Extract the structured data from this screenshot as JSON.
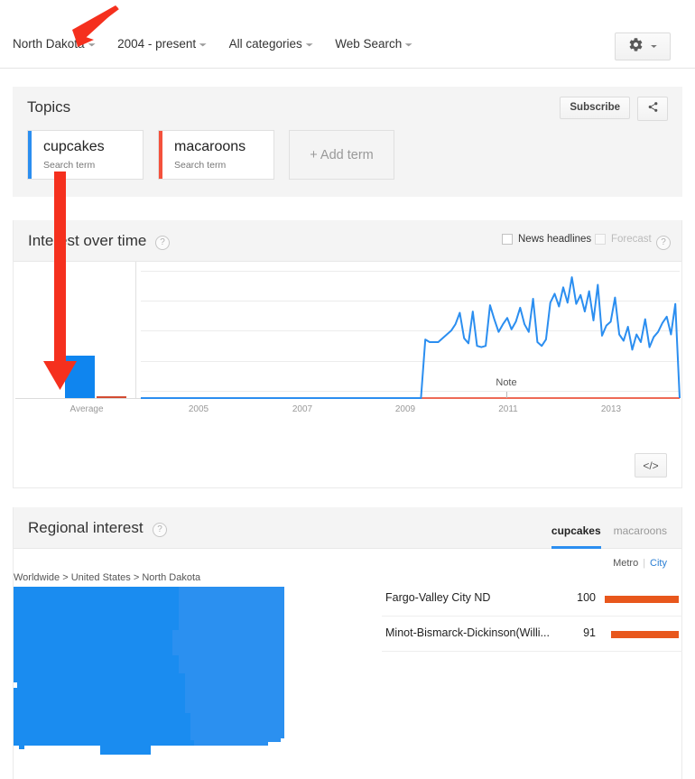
{
  "nav": {
    "items": [
      {
        "label": "North Dakota",
        "name": "region-selector"
      },
      {
        "label": "2004 - present",
        "name": "time-range-selector"
      },
      {
        "label": "All categories",
        "name": "category-selector"
      },
      {
        "label": "Web Search",
        "name": "search-type-selector"
      }
    ],
    "caret": "▾",
    "settings_icon": "gear-icon"
  },
  "topics": {
    "title": "Topics",
    "subscribe_label": "Subscribe",
    "share_icon": "share-icon",
    "terms": [
      {
        "name": "cupcakes",
        "subtitle": "Search term",
        "color": "#2b8ef0"
      },
      {
        "name": "macaroons",
        "subtitle": "Search term",
        "color": "#f4513c"
      }
    ],
    "add_term_label": "+ Add term"
  },
  "interest_over_time": {
    "title": "Interest over time",
    "help": "?",
    "news_headlines_label": "News headlines",
    "forecast_label": "Forecast",
    "embed_label": "</>",
    "note_label": "Note"
  },
  "regional_interest": {
    "title": "Regional interest",
    "help": "?",
    "tabs": [
      {
        "label": "cupcakes",
        "active": true
      },
      {
        "label": "macaroons",
        "active": false
      }
    ],
    "metro_label": "Metro",
    "city_label": "City",
    "breadcrumb": [
      "Worldwide",
      "United States",
      "North Dakota"
    ],
    "breadcrumb_sep": ">",
    "regions": [
      {
        "name": "Fargo-Valley City ND",
        "value": "100",
        "pct": 100
      },
      {
        "name": "Minot-Bismarck-Dickinson(Willi...",
        "value": "91",
        "pct": 91
      }
    ]
  },
  "chart_data": {
    "type": "line",
    "title": "Interest over time",
    "xlabel": "",
    "ylabel": "",
    "ylim": [
      0,
      100
    ],
    "grid": true,
    "legend": "none",
    "average_bars": {
      "categories": [
        "Average"
      ],
      "series": [
        {
          "name": "cupcakes",
          "value": 33,
          "color": "#0f85ef"
        },
        {
          "name": "macaroons",
          "value": 1,
          "color": "#d34c32"
        }
      ]
    },
    "x_ticks": [
      "Average",
      "2005",
      "2007",
      "2009",
      "2011",
      "2013"
    ],
    "x_start": "2004",
    "x_end": "2014",
    "annotations": [
      {
        "label": "Note",
        "x": "2010-09"
      }
    ],
    "series": [
      {
        "name": "cupcakes",
        "color": "#2b8ef0",
        "values": [
          0,
          0,
          0,
          0,
          0,
          0,
          0,
          0,
          0,
          0,
          0,
          0,
          0,
          0,
          0,
          0,
          0,
          0,
          0,
          0,
          0,
          0,
          0,
          0,
          0,
          0,
          0,
          0,
          0,
          0,
          0,
          0,
          0,
          0,
          0,
          0,
          0,
          0,
          0,
          0,
          0,
          0,
          0,
          0,
          0,
          0,
          0,
          0,
          0,
          0,
          0,
          0,
          0,
          0,
          0,
          0,
          0,
          0,
          0,
          0,
          0,
          0,
          0,
          0,
          0,
          0,
          46,
          44,
          44,
          44,
          47,
          50,
          53,
          58,
          67,
          47,
          43,
          68,
          41,
          40,
          41,
          73,
          62,
          52,
          58,
          63,
          54,
          60,
          71,
          58,
          52,
          78,
          44,
          41,
          46,
          75,
          82,
          72,
          87,
          75,
          95,
          74,
          81,
          68,
          84,
          61,
          89,
          49,
          57,
          60,
          79,
          50,
          45,
          56,
          38,
          50,
          44,
          62,
          40,
          48,
          52,
          59,
          64,
          50,
          74,
          0
        ],
        "values_note": "weekly-sampled 0-100 relative interest, 2004-2014"
      },
      {
        "name": "macaroons",
        "color": "#ee6a56",
        "values_constant": 0
      }
    ]
  },
  "map": {
    "name": "north-dakota-metro-map",
    "regions": [
      {
        "name": "Minot-Bismarck-Dickinson",
        "color": "#2b90f0"
      },
      {
        "name": "Fargo-Valley City",
        "color": "#0f85ef"
      }
    ]
  },
  "annotations": {
    "arrow_color": "#f5301e",
    "arrows": [
      {
        "name": "arrow-to-region-selector",
        "from": "upper-right",
        "to": "North Dakota"
      },
      {
        "name": "arrow-to-average-bar",
        "from": "cupcakes-card",
        "to": "average-bar"
      }
    ]
  }
}
